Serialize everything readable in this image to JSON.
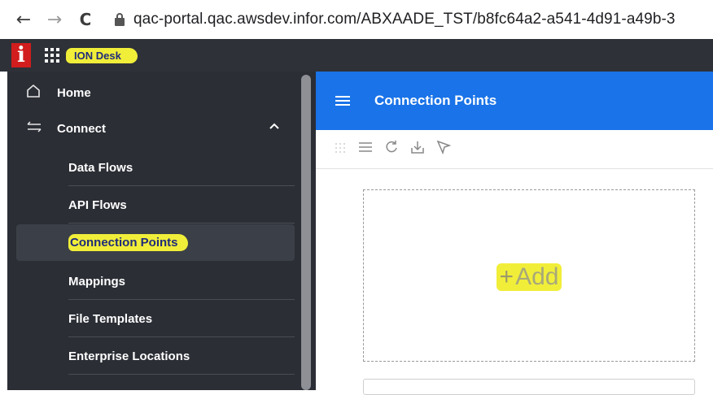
{
  "browser": {
    "back": "←",
    "forward": "→",
    "reload": "C",
    "url": "qac-portal.qac.awsdev.infor.com/ABXAADE_TST/b8fc64a2-a541-4d91-a49b-3"
  },
  "header": {
    "logo": "i",
    "app_title": "ION Desk"
  },
  "sidebar": {
    "home": {
      "icon": "home-icon",
      "label": "Home"
    },
    "connect": {
      "icon": "arrows-icon",
      "label": "Connect",
      "chevron": "^"
    },
    "items": [
      {
        "label": "Data Flows"
      },
      {
        "label": "API Flows"
      },
      {
        "label": "Connection Points",
        "selected": true
      },
      {
        "label": "Mappings"
      },
      {
        "label": "File Templates"
      },
      {
        "label": "Enterprise Locations"
      }
    ]
  },
  "main": {
    "title": "Connection Points",
    "toolbar": [
      "drag-grid-icon",
      "list-icon",
      "refresh-icon",
      "download-icon",
      "select-icon"
    ],
    "add_card": {
      "plus": "+",
      "label": "Add"
    }
  },
  "colors": {
    "highlight": "#f1ee3a",
    "header_blue": "#1a73e8",
    "sidebar_bg": "#2b2e35",
    "logo_red": "#d11d1d"
  }
}
